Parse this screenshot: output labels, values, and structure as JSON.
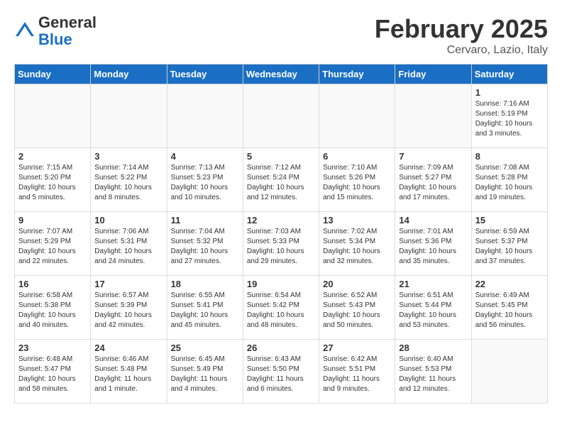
{
  "logo": {
    "general": "General",
    "blue": "Blue"
  },
  "header": {
    "month": "February 2025",
    "location": "Cervaro, Lazio, Italy"
  },
  "days_of_week": [
    "Sunday",
    "Monday",
    "Tuesday",
    "Wednesday",
    "Thursday",
    "Friday",
    "Saturday"
  ],
  "weeks": [
    [
      {
        "day": "",
        "info": ""
      },
      {
        "day": "",
        "info": ""
      },
      {
        "day": "",
        "info": ""
      },
      {
        "day": "",
        "info": ""
      },
      {
        "day": "",
        "info": ""
      },
      {
        "day": "",
        "info": ""
      },
      {
        "day": "1",
        "info": "Sunrise: 7:16 AM\nSunset: 5:19 PM\nDaylight: 10 hours and 3 minutes."
      }
    ],
    [
      {
        "day": "2",
        "info": "Sunrise: 7:15 AM\nSunset: 5:20 PM\nDaylight: 10 hours and 5 minutes."
      },
      {
        "day": "3",
        "info": "Sunrise: 7:14 AM\nSunset: 5:22 PM\nDaylight: 10 hours and 8 minutes."
      },
      {
        "day": "4",
        "info": "Sunrise: 7:13 AM\nSunset: 5:23 PM\nDaylight: 10 hours and 10 minutes."
      },
      {
        "day": "5",
        "info": "Sunrise: 7:12 AM\nSunset: 5:24 PM\nDaylight: 10 hours and 12 minutes."
      },
      {
        "day": "6",
        "info": "Sunrise: 7:10 AM\nSunset: 5:26 PM\nDaylight: 10 hours and 15 minutes."
      },
      {
        "day": "7",
        "info": "Sunrise: 7:09 AM\nSunset: 5:27 PM\nDaylight: 10 hours and 17 minutes."
      },
      {
        "day": "8",
        "info": "Sunrise: 7:08 AM\nSunset: 5:28 PM\nDaylight: 10 hours and 19 minutes."
      }
    ],
    [
      {
        "day": "9",
        "info": "Sunrise: 7:07 AM\nSunset: 5:29 PM\nDaylight: 10 hours and 22 minutes."
      },
      {
        "day": "10",
        "info": "Sunrise: 7:06 AM\nSunset: 5:31 PM\nDaylight: 10 hours and 24 minutes."
      },
      {
        "day": "11",
        "info": "Sunrise: 7:04 AM\nSunset: 5:32 PM\nDaylight: 10 hours and 27 minutes."
      },
      {
        "day": "12",
        "info": "Sunrise: 7:03 AM\nSunset: 5:33 PM\nDaylight: 10 hours and 29 minutes."
      },
      {
        "day": "13",
        "info": "Sunrise: 7:02 AM\nSunset: 5:34 PM\nDaylight: 10 hours and 32 minutes."
      },
      {
        "day": "14",
        "info": "Sunrise: 7:01 AM\nSunset: 5:36 PM\nDaylight: 10 hours and 35 minutes."
      },
      {
        "day": "15",
        "info": "Sunrise: 6:59 AM\nSunset: 5:37 PM\nDaylight: 10 hours and 37 minutes."
      }
    ],
    [
      {
        "day": "16",
        "info": "Sunrise: 6:58 AM\nSunset: 5:38 PM\nDaylight: 10 hours and 40 minutes."
      },
      {
        "day": "17",
        "info": "Sunrise: 6:57 AM\nSunset: 5:39 PM\nDaylight: 10 hours and 42 minutes."
      },
      {
        "day": "18",
        "info": "Sunrise: 6:55 AM\nSunset: 5:41 PM\nDaylight: 10 hours and 45 minutes."
      },
      {
        "day": "19",
        "info": "Sunrise: 6:54 AM\nSunset: 5:42 PM\nDaylight: 10 hours and 48 minutes."
      },
      {
        "day": "20",
        "info": "Sunrise: 6:52 AM\nSunset: 5:43 PM\nDaylight: 10 hours and 50 minutes."
      },
      {
        "day": "21",
        "info": "Sunrise: 6:51 AM\nSunset: 5:44 PM\nDaylight: 10 hours and 53 minutes."
      },
      {
        "day": "22",
        "info": "Sunrise: 6:49 AM\nSunset: 5:45 PM\nDaylight: 10 hours and 56 minutes."
      }
    ],
    [
      {
        "day": "23",
        "info": "Sunrise: 6:48 AM\nSunset: 5:47 PM\nDaylight: 10 hours and 58 minutes."
      },
      {
        "day": "24",
        "info": "Sunrise: 6:46 AM\nSunset: 5:48 PM\nDaylight: 11 hours and 1 minute."
      },
      {
        "day": "25",
        "info": "Sunrise: 6:45 AM\nSunset: 5:49 PM\nDaylight: 11 hours and 4 minutes."
      },
      {
        "day": "26",
        "info": "Sunrise: 6:43 AM\nSunset: 5:50 PM\nDaylight: 11 hours and 6 minutes."
      },
      {
        "day": "27",
        "info": "Sunrise: 6:42 AM\nSunset: 5:51 PM\nDaylight: 11 hours and 9 minutes."
      },
      {
        "day": "28",
        "info": "Sunrise: 6:40 AM\nSunset: 5:53 PM\nDaylight: 11 hours and 12 minutes."
      },
      {
        "day": "",
        "info": ""
      }
    ]
  ]
}
